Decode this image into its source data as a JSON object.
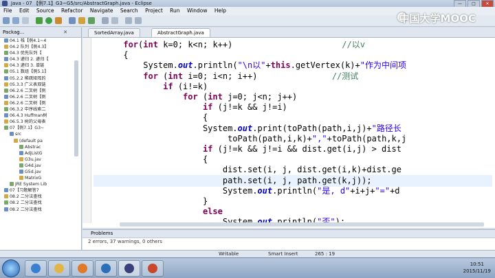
{
  "window": {
    "title": "Java - 07 【例7.1】G3~G5/src/AbstractGraph.java - Eclipse",
    "min": "—",
    "max": "□",
    "close": "✕"
  },
  "menu": [
    "File",
    "Edit",
    "Source",
    "Refactor",
    "Navigate",
    "Search",
    "Project",
    "Run",
    "Window",
    "Help"
  ],
  "watermark": "中国大学MOOC",
  "package_explorer": {
    "tab_label": "Packag...",
    "items": [
      "04.1 栈【例4.1~4",
      "04.2 队列【例4.3】",
      "04.3 优先队列【",
      "04.3 递归 2. 递归【",
      "04.3 递归 3. 单链",
      "05.1 数组【例5.1】",
      "05.2.2 稀疏矩阵的",
      "05.3.3 广义表双链",
      "06.2.6 二叉树【例",
      "06.2.6 二叉树【例",
      "06.2.6 二叉树【例",
      "06.3.2 中序线索二",
      "06.4.3 Huffman树",
      "06.5.3 树的父母表",
      "07【例7.1】G3~",
      "src",
      "(default pa",
      "Abstrac",
      "AdjListG",
      "G3u.jav",
      "G4d.jav",
      "G5d.jav",
      "MatrixG",
      "JRE System Lib",
      "07【习题解答7",
      "08.2 二分法查找",
      "08.2 二分法查找",
      "08.2 二分法查找"
    ]
  },
  "editor": {
    "tabs": [
      "SortedArray.java",
      "AbstractGraph.java"
    ],
    "active_tab": 1,
    "lines": [
      {
        "indent": "      ",
        "parts": [
          [
            "kw",
            "for"
          ],
          [
            "",
            "("
          ],
          [
            "kw",
            "int"
          ],
          [
            "",
            " k=0; k<n; k++)"
          ],
          [
            "",
            "                      "
          ],
          [
            "cm",
            "//以v"
          ]
        ]
      },
      {
        "indent": "      ",
        "parts": [
          [
            "",
            "{"
          ]
        ]
      },
      {
        "indent": "          ",
        "parts": [
          [
            "",
            "System."
          ],
          [
            "it",
            "out"
          ],
          [
            "",
            ".println("
          ],
          [
            "str",
            "\"\\n以\""
          ],
          [
            "",
            "+"
          ],
          [
            "kw",
            "this"
          ],
          [
            "",
            ".getVertex(k)+"
          ],
          [
            "str",
            "\"作为中间项"
          ]
        ]
      },
      {
        "indent": "          ",
        "parts": [
          [
            "kw",
            "for"
          ],
          [
            "",
            " ("
          ],
          [
            "kw",
            "int"
          ],
          [
            "",
            " i=0; i<n; i++)"
          ],
          [
            "",
            "               "
          ],
          [
            "cm",
            "//测试"
          ]
        ]
      },
      {
        "indent": "              ",
        "parts": [
          [
            "kw",
            "if"
          ],
          [
            "",
            " (i!=k)"
          ]
        ]
      },
      {
        "indent": "                  ",
        "parts": [
          [
            "kw",
            "for"
          ],
          [
            "",
            " ("
          ],
          [
            "kw",
            "int"
          ],
          [
            "",
            " j=0; j<n; j++)"
          ]
        ]
      },
      {
        "indent": "                      ",
        "parts": [
          [
            "kw",
            "if"
          ],
          [
            "",
            " (j!=k && j!=i)"
          ]
        ]
      },
      {
        "indent": "                      ",
        "parts": [
          [
            "",
            "{"
          ]
        ]
      },
      {
        "indent": "                      ",
        "parts": [
          [
            "",
            "System."
          ],
          [
            "it",
            "out"
          ],
          [
            "",
            ".print(toPath(path,i,j)+"
          ],
          [
            "str",
            "\"路径长"
          ]
        ]
      },
      {
        "indent": "                           ",
        "parts": [
          [
            "",
            "toPath(path,i,k)+"
          ],
          [
            "str",
            "\",\""
          ],
          [
            "",
            "+toPath(path,k,j"
          ]
        ]
      },
      {
        "indent": "                      ",
        "parts": [
          [
            "kw",
            "if"
          ],
          [
            "",
            " (j!=k && j!=i && dist.get(i,j) > dist"
          ]
        ]
      },
      {
        "indent": "                      ",
        "parts": [
          [
            "",
            "{"
          ]
        ]
      },
      {
        "indent": "                          ",
        "parts": [
          [
            "",
            "dist.set(i, j, dist.get(i,k)+dist.ge"
          ]
        ]
      },
      {
        "indent": "                          ",
        "parts": [
          [
            "",
            "path.set(i, j, path.get(k,j));"
          ]
        ],
        "highlight": true
      },
      {
        "indent": "                          ",
        "parts": [
          [
            "",
            "System."
          ],
          [
            "it",
            "out"
          ],
          [
            "",
            ".println("
          ],
          [
            "str",
            "\"是, d\""
          ],
          [
            "",
            "+i+j+"
          ],
          [
            "str",
            "\"=\""
          ],
          [
            "",
            "+d"
          ]
        ]
      },
      {
        "indent": "                      ",
        "parts": [
          [
            "",
            "}"
          ]
        ]
      },
      {
        "indent": "                      ",
        "parts": [
          [
            "kw",
            "else"
          ]
        ]
      },
      {
        "indent": "                          ",
        "parts": [
          [
            "",
            "System."
          ],
          [
            "it",
            "out"
          ],
          [
            "",
            ".println("
          ],
          [
            "str",
            "\"否\""
          ],
          [
            "",
            ");"
          ]
        ]
      }
    ]
  },
  "problems": {
    "tab_label": "Problems",
    "summary": "2 errors, 37 warnings, 0 others"
  },
  "status": {
    "writable": "Writable",
    "insert_mode": "Smart Insert",
    "position": "265 : 19"
  },
  "taskbar": {
    "time": "10:51",
    "date": "2015/11/19"
  }
}
